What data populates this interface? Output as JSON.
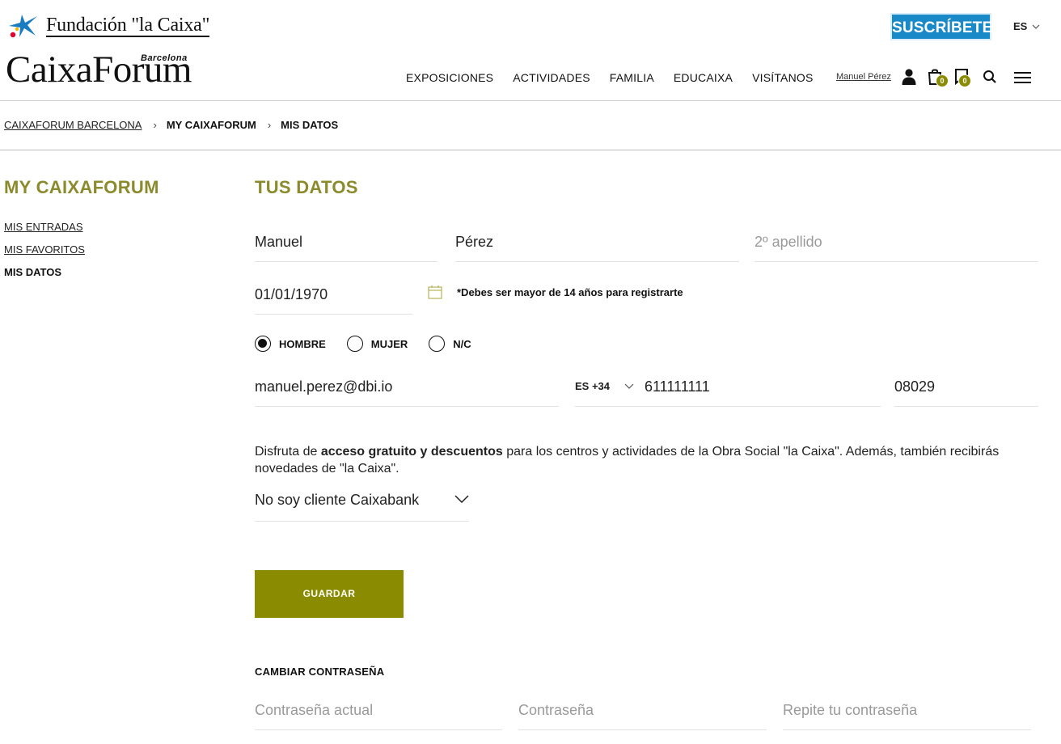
{
  "header": {
    "foundation_name": "Fundación \"la Caixa\"",
    "brand_name": "CaixaForum",
    "brand_city": "Barcelona",
    "subscribe_label": "SUSCRÍBETE",
    "language": "ES",
    "nav": [
      "EXPOSICIONES",
      "ACTIVIDADES",
      "FAMILIA",
      "EDUCAIXA",
      "VISÍTANOS"
    ],
    "user_name": "Manuel Pérez",
    "cart_count": "0",
    "favorites_count": "0",
    "icons": [
      "user-icon",
      "cart-icon",
      "bookmark-icon",
      "search-icon",
      "menu-icon"
    ]
  },
  "breadcrumb": [
    "CAIXAFORUM BARCELONA",
    "MY CAIXAFORUM",
    "MIS DATOS"
  ],
  "sidebar": {
    "title": "MY CAIXAFORUM",
    "items": [
      {
        "label": "MIS ENTRADAS",
        "active": false
      },
      {
        "label": "MIS FAVORITOS",
        "active": false
      },
      {
        "label": "MIS DATOS",
        "active": true
      }
    ]
  },
  "form": {
    "title": "TUS DATOS",
    "first_name": "Manuel",
    "last_name": "Pérez",
    "second_last_name_placeholder": "2º apellido",
    "birthdate": "01/01/1970",
    "age_note": "*Debes ser mayor de 14 años para registrarte",
    "gender_options": [
      {
        "label": "HOMBRE",
        "selected": true
      },
      {
        "label": "MUJER",
        "selected": false
      },
      {
        "label": "N/C",
        "selected": false
      }
    ],
    "email": "manuel.perez@dbi.io",
    "phone_prefix": "ES +34",
    "phone": "611111111",
    "postal_code": "08029",
    "promo_before": "Disfruta de ",
    "promo_bold": "acceso gratuito y descuentos",
    "promo_after": " para los centros y actividades de la Obra Social \"la Caixa\". Además, también recibirás",
    "promo_line2": "novedades de \"la Caixa\".",
    "client_select": "No soy cliente Caixabank",
    "save_label": "GUARDAR"
  },
  "password": {
    "title": "CAMBIAR CONTRASEÑA",
    "current_placeholder": "Contraseña actual",
    "new_placeholder": "Contraseña",
    "repeat_placeholder": "Repite tu contraseña"
  },
  "colors": {
    "accent_olive": "#8b8b00",
    "title_olive": "#8b8b2e",
    "subscribe_blue": "#1a89c8"
  }
}
